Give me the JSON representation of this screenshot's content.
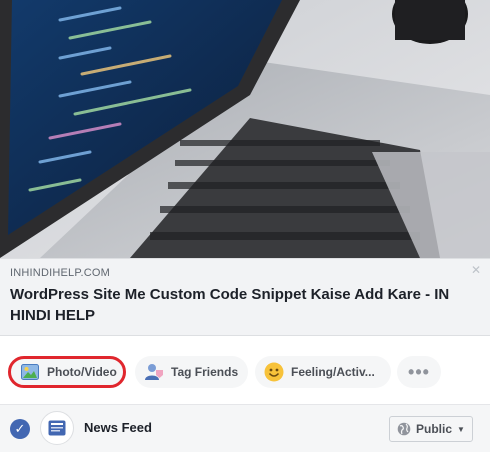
{
  "link_preview": {
    "domain": "INHINDIHELP.COM",
    "title": "WordPress Site Me Custom Code Snippet Kaise Add Kare - IN HINDI HELP",
    "close_glyph": "✕"
  },
  "actions": {
    "photo_video_label": "Photo/Video",
    "tag_friends_label": "Tag Friends",
    "feeling_label": "Feeling/Activ...",
    "more_label": "•••",
    "highlight_color": "#e0262d"
  },
  "footer": {
    "check_glyph": "✓",
    "news_feed_label": "News Feed",
    "audience_label": "Public",
    "audience_caret": "▼"
  },
  "icons": {
    "photo": "photo-icon",
    "tag": "tag-friends-icon",
    "feeling": "smiley-icon",
    "news_feed": "news-feed-icon",
    "globe": "globe-icon"
  },
  "colors": {
    "brand_blue": "#4267b2",
    "text_primary": "#1d2129",
    "text_secondary": "#606770"
  }
}
